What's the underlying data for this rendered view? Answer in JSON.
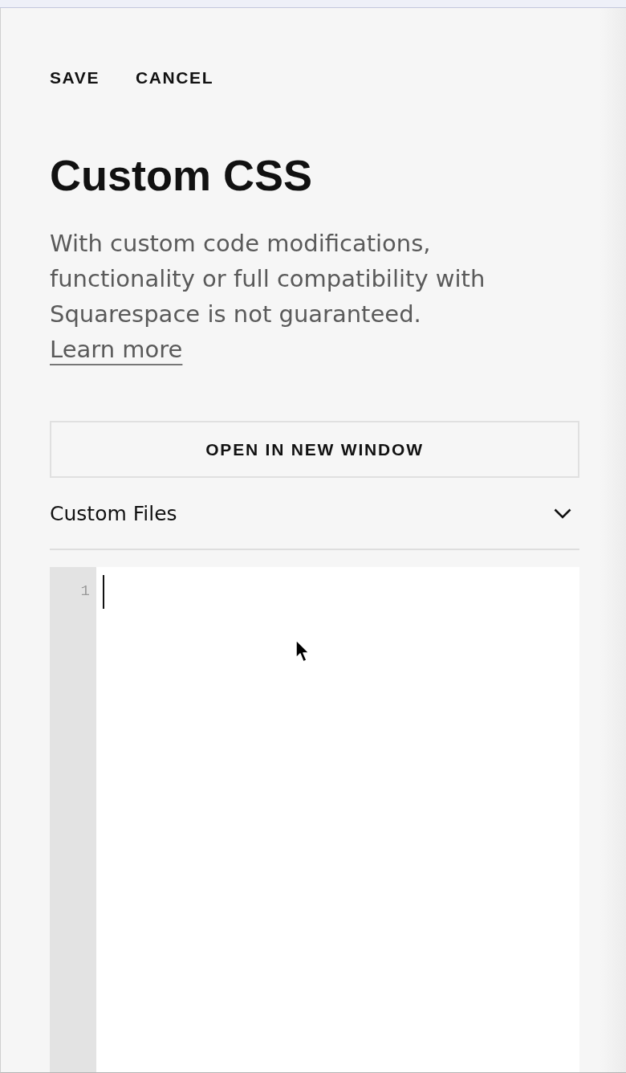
{
  "toolbar": {
    "buttons": [
      {
        "label": "SAVE"
      },
      {
        "label": "CANCEL"
      }
    ]
  },
  "title": "Custom CSS",
  "description": {
    "text": "With custom code modifications, functionality or full compatibility with Squarespace is not guaranteed.",
    "link": "Learn more"
  },
  "open_button": {
    "label": "OPEN IN NEW WINDOW"
  },
  "custom_files": {
    "label": "Custom Files",
    "expanded": false
  },
  "editor": {
    "line_numbers": [
      "1"
    ],
    "focused": true
  }
}
